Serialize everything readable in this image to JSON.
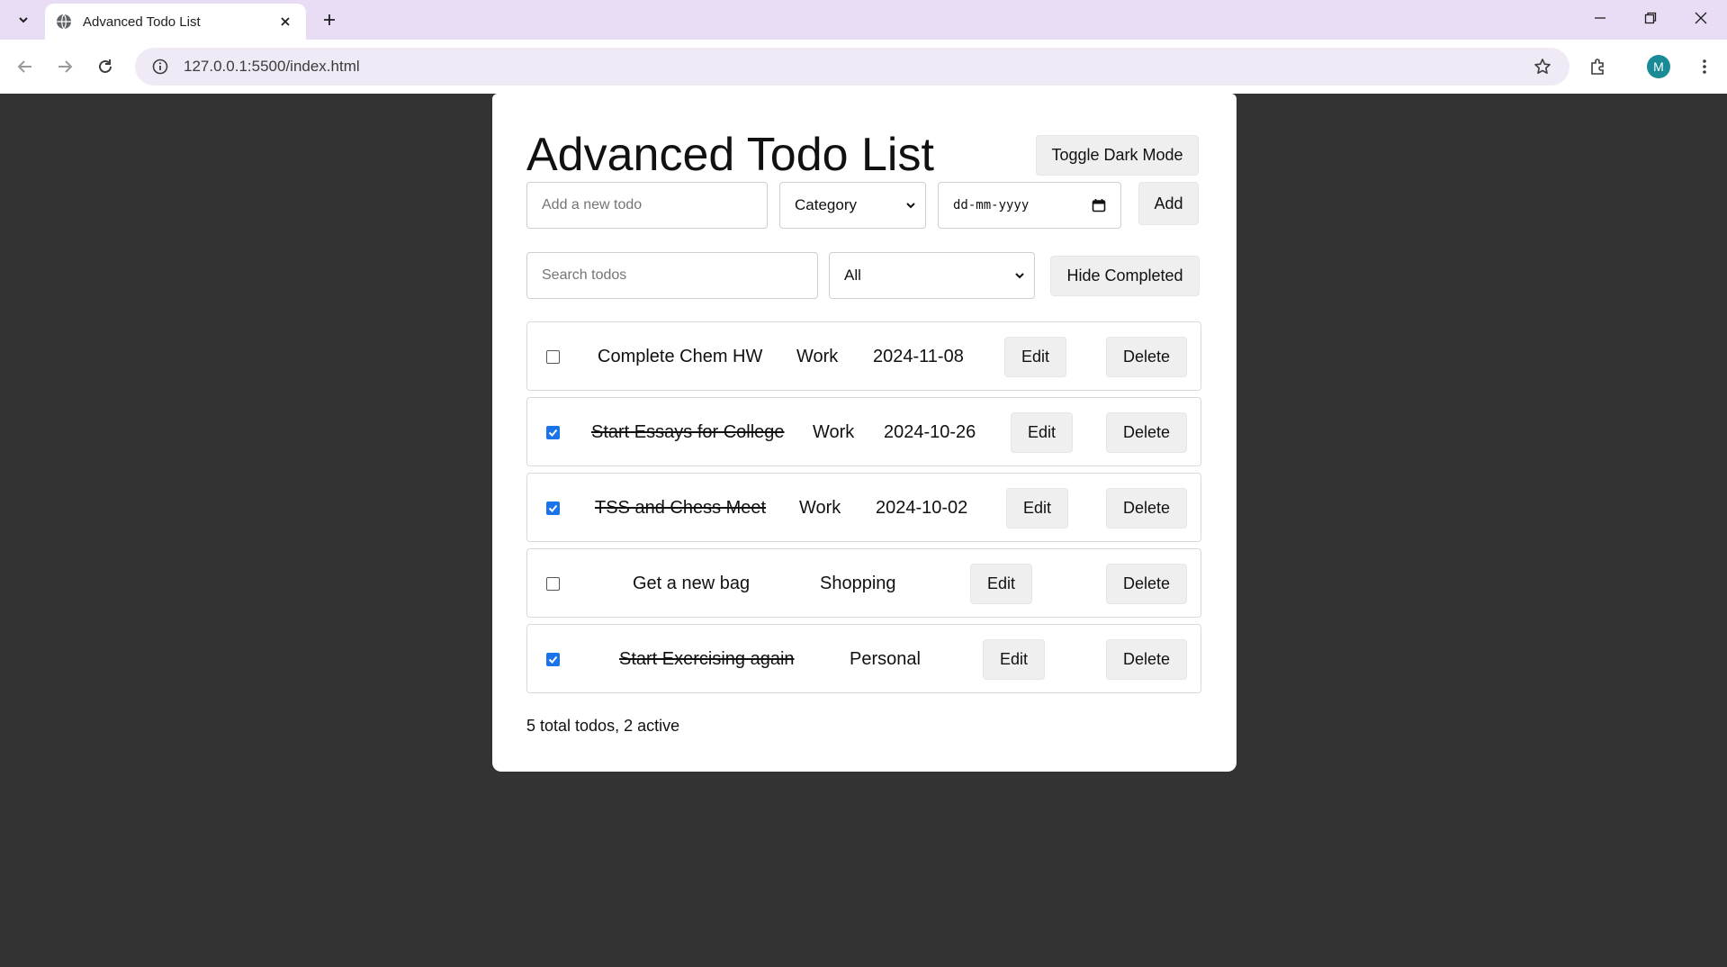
{
  "browser": {
    "tab_title": "Advanced Todo List",
    "url": "127.0.0.1:5500/index.html",
    "profile_initial": "M"
  },
  "app": {
    "title": "Advanced Todo List",
    "dark_mode_label": "Toggle Dark Mode",
    "new_todo_placeholder": "Add a new todo",
    "category_select": "Category",
    "date_placeholder": "dd-mm-yyyy",
    "add_label": "Add",
    "search_placeholder": "Search todos",
    "filter_select": "All",
    "hide_completed_label": "Hide Completed",
    "edit_label": "Edit",
    "delete_label": "Delete",
    "stats": "5 total todos, 2 active"
  },
  "todos": [
    {
      "text": "Complete Chem HW",
      "category": "Work",
      "date": "2024-11-08",
      "completed": false
    },
    {
      "text": "Start Essays for College",
      "category": "Work",
      "date": "2024-10-26",
      "completed": true
    },
    {
      "text": "TSS and Chess Meet",
      "category": "Work",
      "date": "2024-10-02",
      "completed": true
    },
    {
      "text": "Get a new bag",
      "category": "Shopping",
      "date": "",
      "completed": false
    },
    {
      "text": "Start Exercising again",
      "category": "Personal",
      "date": "",
      "completed": true
    }
  ],
  "colors": {
    "page_background": "#333333",
    "card_background": "#ffffff",
    "checkbox_checked": "#1a73e8",
    "tabstrip": "#e9ddf6"
  }
}
